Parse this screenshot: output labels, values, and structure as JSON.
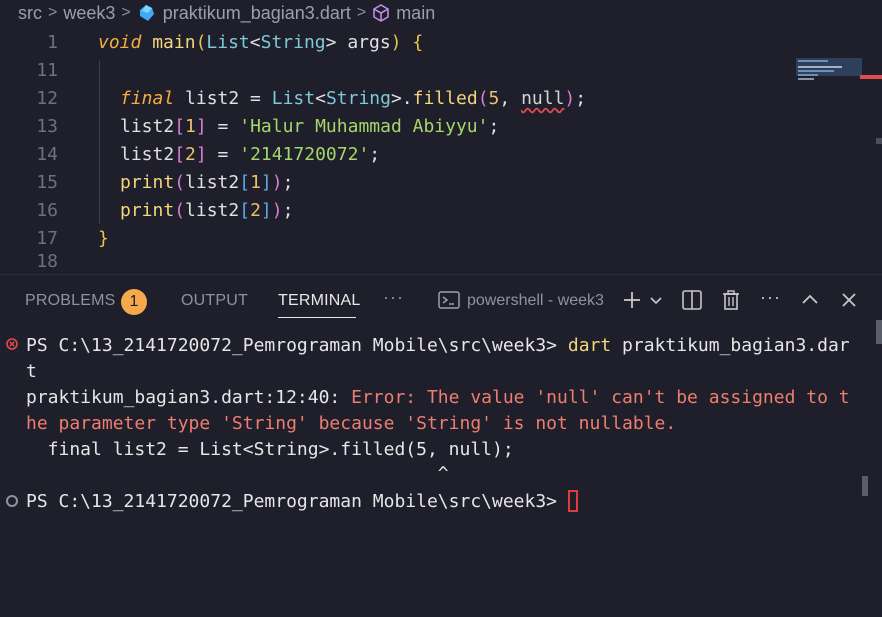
{
  "breadcrumb": {
    "items": [
      "src",
      "week3",
      "praktikum_bagian3.dart",
      "main"
    ]
  },
  "editor": {
    "lines": [
      {
        "num": "1",
        "tokens": [
          [
            "kw-it",
            "void"
          ],
          [
            "plain",
            " "
          ],
          [
            "fn",
            "main"
          ],
          [
            "paren-y",
            "("
          ],
          [
            "ty",
            "List"
          ],
          [
            "plain",
            "<"
          ],
          [
            "ty",
            "String"
          ],
          [
            "plain",
            "> args"
          ],
          [
            "paren-y",
            ")"
          ],
          [
            "plain",
            " "
          ],
          [
            "paren-y",
            "{"
          ]
        ]
      },
      {
        "num": "11",
        "tokens": []
      },
      {
        "num": "12",
        "tokens": [
          [
            "kw-it",
            "final"
          ],
          [
            "plain",
            " list2 = "
          ],
          [
            "ty",
            "List"
          ],
          [
            "plain",
            "<"
          ],
          [
            "ty",
            "String"
          ],
          [
            "plain",
            ">."
          ],
          [
            "fn",
            "filled"
          ],
          [
            "paren-p",
            "("
          ],
          [
            "num",
            "5"
          ],
          [
            "plain",
            ", "
          ],
          [
            "squig",
            "null"
          ],
          [
            "paren-p",
            ")"
          ],
          [
            "plain",
            ";"
          ]
        ]
      },
      {
        "num": "13",
        "tokens": [
          [
            "plain",
            "list2"
          ],
          [
            "paren-p",
            "["
          ],
          [
            "num",
            "1"
          ],
          [
            "paren-p",
            "]"
          ],
          [
            "plain",
            " = "
          ],
          [
            "str",
            "'Halur Muhammad Abiyyu'"
          ],
          [
            "plain",
            ";"
          ]
        ]
      },
      {
        "num": "14",
        "tokens": [
          [
            "plain",
            "list2"
          ],
          [
            "paren-p",
            "["
          ],
          [
            "num",
            "2"
          ],
          [
            "paren-p",
            "]"
          ],
          [
            "plain",
            " = "
          ],
          [
            "str",
            "'2141720072'"
          ],
          [
            "plain",
            ";"
          ]
        ]
      },
      {
        "num": "15",
        "tokens": [
          [
            "fn",
            "print"
          ],
          [
            "paren-p",
            "("
          ],
          [
            "plain",
            "list2"
          ],
          [
            "paren-b",
            "["
          ],
          [
            "num",
            "1"
          ],
          [
            "paren-b",
            "]"
          ],
          [
            "paren-p",
            ")"
          ],
          [
            "plain",
            ";"
          ]
        ]
      },
      {
        "num": "16",
        "tokens": [
          [
            "fn",
            "print"
          ],
          [
            "paren-p",
            "("
          ],
          [
            "plain",
            "list2"
          ],
          [
            "paren-b",
            "["
          ],
          [
            "num",
            "2"
          ],
          [
            "paren-b",
            "]"
          ],
          [
            "paren-p",
            ")"
          ],
          [
            "plain",
            ";"
          ]
        ]
      },
      {
        "num": "17",
        "tokens": [
          [
            "paren-y",
            "}"
          ]
        ]
      },
      {
        "num": "18",
        "tokens": []
      }
    ]
  },
  "panel": {
    "tabs": {
      "problems": "PROBLEMS",
      "problems_count": "1",
      "output": "OUTPUT",
      "terminal": "TERMINAL",
      "more": "···"
    },
    "shell_label": "powershell - week3",
    "toolbar_more": "···"
  },
  "terminal": {
    "cmd_prompt": "PS C:\\13_2141720072_Pemrograman Mobile\\src\\week3> ",
    "cmd_part1": "dart",
    "cmd_part2": " praktikum_bagian3.dar",
    "cmd_wrap": "t",
    "err_loc": "praktikum_bagian3.dart:12:40: ",
    "err_msg1": "Error: The value 'null' can't be assigned to t",
    "err_msg2": "he parameter type 'String' because 'String' is not nullable.",
    "src_line": "  final list2 = List<String>.filled(5, null);",
    "caret_line": "                                      ^",
    "prompt2": "PS C:\\13_2141720072_Pemrograman Mobile\\src\\week3> "
  },
  "colors": {
    "background": "#1e1f2b",
    "error": "#f07d6e",
    "badge": "#f5a94a",
    "keyword": "#f6ad3c",
    "string": "#a7d66a"
  }
}
